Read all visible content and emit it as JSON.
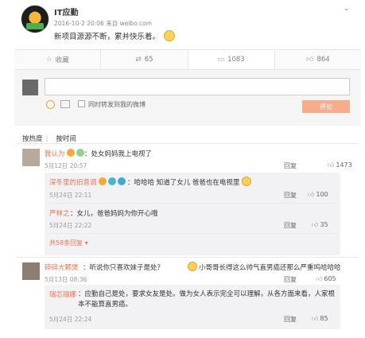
{
  "post": {
    "author": "IT应勤",
    "meta": "2016-10-2 20:06 来自 weibo.com",
    "text": "新项目源源不断，累并快乐着。",
    "dropdown_icon": "chevron-down-icon"
  },
  "actions": [
    {
      "icon": "star-icon",
      "label": "收藏"
    },
    {
      "icon": "repost-icon",
      "label": "65"
    },
    {
      "icon": "comment-icon",
      "label": "1083"
    },
    {
      "icon": "thumbs-up-icon",
      "label": "864"
    }
  ],
  "compose": {
    "repost_label": "同时转发到我的微博",
    "submit_label": "评论"
  },
  "sort": {
    "hot": "按热度",
    "time": "按时间"
  },
  "comments": [
    {
      "user": "我认为",
      "text": "：处女妈妈我上电视了",
      "date": "5月12日 20:57",
      "reply": "回复",
      "likes": "1473",
      "replies": [
        {
          "user": "深冬里的旧音调",
          "text": "：哈哈哈  知道了女儿 爸爸也在电视里",
          "date": "5月24日 22:11",
          "reply": "回复",
          "likes": "100"
        },
        {
          "user": "严林之",
          "text": "：女儿，爸爸妈妈为你开心哦",
          "date": "5月24日 22:22",
          "reply": "回复",
          "likes": "35"
        }
      ],
      "more": "共58条回复"
    },
    {
      "user": "碎碎大颗煲",
      "text": "：听说你只喜欢妹子是处？",
      "text2": "小哥哥长得这么帅气直男癌还那么严重呜哈哈哈",
      "date": "5月13日 08:36",
      "reply": "回复",
      "likes": "605",
      "replies": [
        {
          "user": "瑞芯瑞娜",
          "text": "：应勤自己是处，要求女友是处。做为女人表示完全可以理解，从各方面来看，人家根本不能算直男癌。",
          "date": "5月24日 22:24",
          "reply": "回复",
          "likes": "85"
        }
      ]
    }
  ]
}
